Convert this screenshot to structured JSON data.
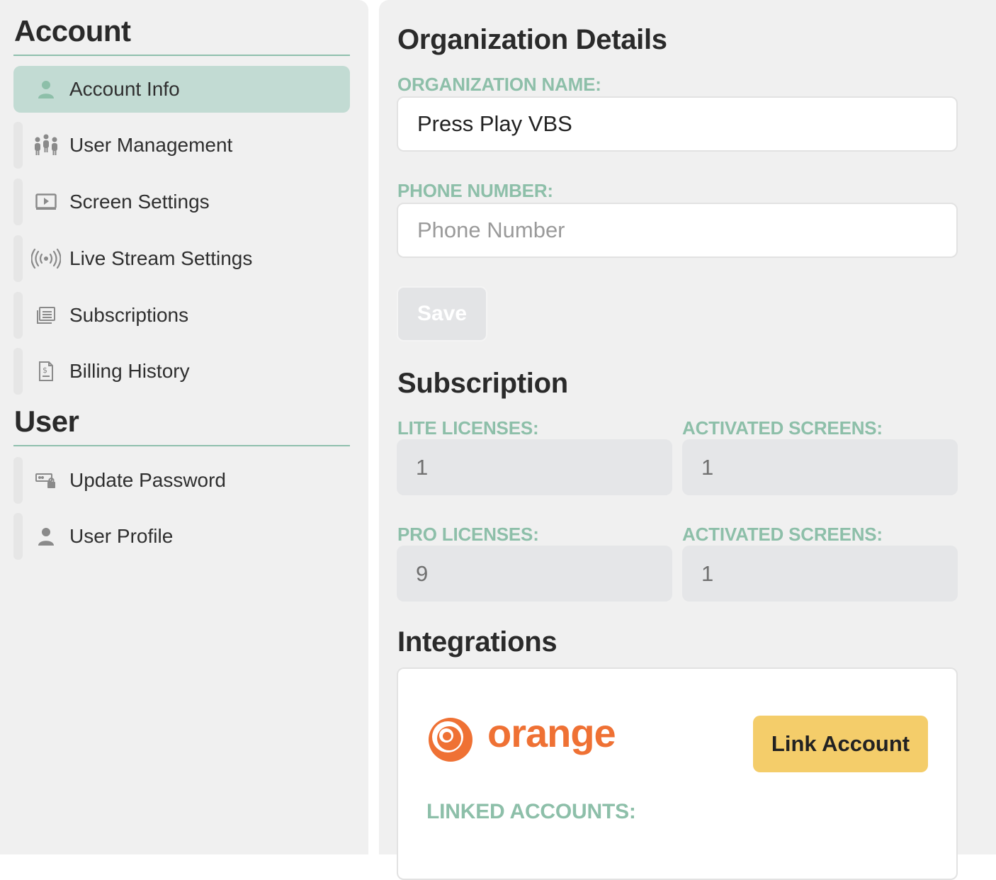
{
  "sidebar": {
    "account_heading": "Account",
    "user_heading": "User",
    "account_items": [
      {
        "label": "Account Info",
        "icon": "person-icon",
        "active": true
      },
      {
        "label": "User Management",
        "icon": "users-group-icon"
      },
      {
        "label": "Screen Settings",
        "icon": "screen-play-icon"
      },
      {
        "label": "Live Stream Settings",
        "icon": "broadcast-icon"
      },
      {
        "label": "Subscriptions",
        "icon": "subscriptions-list-icon"
      },
      {
        "label": "Billing History",
        "icon": "billing-document-icon"
      }
    ],
    "user_items": [
      {
        "label": "Update Password",
        "icon": "password-lock-icon"
      },
      {
        "label": "User Profile",
        "icon": "person-icon"
      }
    ]
  },
  "main": {
    "org_title": "Organization Details",
    "org_name_label": "ORGANIZATION NAME:",
    "org_name_value": "Press Play VBS",
    "phone_label": "PHONE NUMBER:",
    "phone_placeholder": "Phone Number",
    "phone_value": "",
    "save_label": "Save",
    "subscription_title": "Subscription",
    "lite_licenses_label": "LITE LICENSES:",
    "lite_licenses_value": "1",
    "lite_activated_label": "ACTIVATED SCREENS:",
    "lite_activated_value": "1",
    "pro_licenses_label": "PRO LICENSES:",
    "pro_licenses_value": "9",
    "pro_activated_label": "ACTIVATED SCREENS:",
    "pro_activated_value": "1",
    "integrations_title": "Integrations",
    "integration_brand": "orange",
    "link_button_label": "Link Account",
    "linked_accounts_label": "LINKED ACCOUNTS:"
  },
  "colors": {
    "accent_green": "#8dbfa9",
    "active_nav_bg": "#c2dbd3",
    "link_button": "#f4cd6a",
    "brand_orange": "#ef7134"
  }
}
